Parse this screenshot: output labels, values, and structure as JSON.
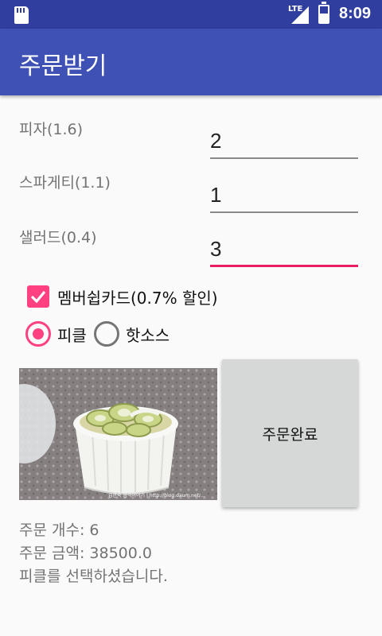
{
  "status_bar": {
    "network_label": "LTE",
    "time": "8:09",
    "icons": [
      "sd-card-icon",
      "signal-icon",
      "battery-icon"
    ],
    "background": "#303f9f"
  },
  "app_bar": {
    "title": "주문받기",
    "background": "#3f51b5"
  },
  "form": {
    "items": [
      {
        "label": "피자(1.6)",
        "value": "2"
      },
      {
        "label": "스파게티(1.1)",
        "value": "1"
      },
      {
        "label": "샐러드(0.4)",
        "value": "3"
      }
    ],
    "focused_index": 2
  },
  "membership": {
    "label": "멤버쉽카드(0.7% 할인)",
    "checked": true
  },
  "sauce_options": {
    "items": [
      {
        "label": "피클",
        "selected": true
      },
      {
        "label": "핫소스",
        "selected": false
      }
    ]
  },
  "photo": {
    "caption": "김한숙 음식이야기 | http://blog.daum.net/..."
  },
  "order_button": {
    "label": "주문완료"
  },
  "result": {
    "count_text": "주문 개수: 6",
    "price_text": "주문 금액: 38500.0",
    "selection_text": "피클를 선택하셨습니다."
  },
  "colors": {
    "accent": "#ff4081",
    "focus_underline": "#e91e63",
    "primary": "#3f51b5",
    "primary_dark": "#303f9f"
  }
}
